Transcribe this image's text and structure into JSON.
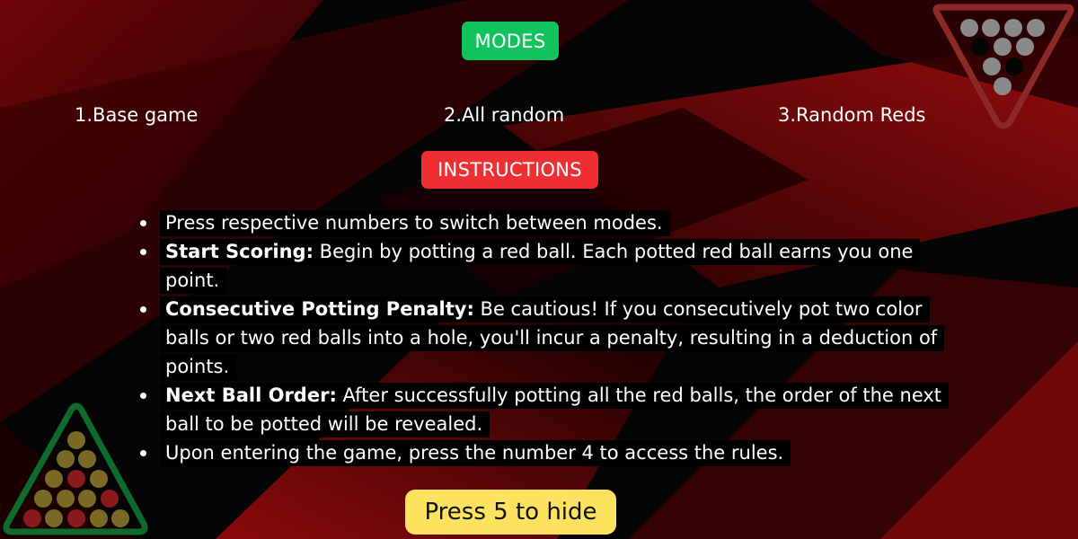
{
  "colors": {
    "background": "#050505",
    "accent_red": "#b00d10",
    "modes_badge": "#11c25d",
    "instructions_badge": "#ef2f31",
    "hide_button": "#fde25f",
    "rack_top": "#8c2a28",
    "rack_bottom": "#0f6a2e"
  },
  "modes": {
    "heading": "MODES",
    "items": [
      {
        "label": "1.Base game"
      },
      {
        "label": "2.All random"
      },
      {
        "label": "3.Random Reds"
      }
    ]
  },
  "instructions": {
    "heading": "INSTRUCTIONS",
    "items": [
      {
        "bold": "",
        "text": "Press respective numbers to switch between modes."
      },
      {
        "bold": "Start Scoring:",
        "text": " Begin by potting a red ball. Each potted red ball earns you one point."
      },
      {
        "bold": "Consecutive Potting Penalty:",
        "text": " Be cautious! If you consecutively pot two color balls or two red balls into a hole, you'll incur a penalty, resulting in a deduction of points."
      },
      {
        "bold": "Next Ball Order:",
        "text": " After successfully potting all the red balls, the order of the next ball to be potted will be revealed."
      },
      {
        "bold": "",
        "text": "Upon entering the game, press the number 4 to access the rules."
      }
    ]
  },
  "hide_button": {
    "label": "Press 5 to hide"
  },
  "icons": {
    "top_right": "snooker-rack-triangle-icon",
    "bottom_left": "snooker-rack-triangle-icon"
  }
}
